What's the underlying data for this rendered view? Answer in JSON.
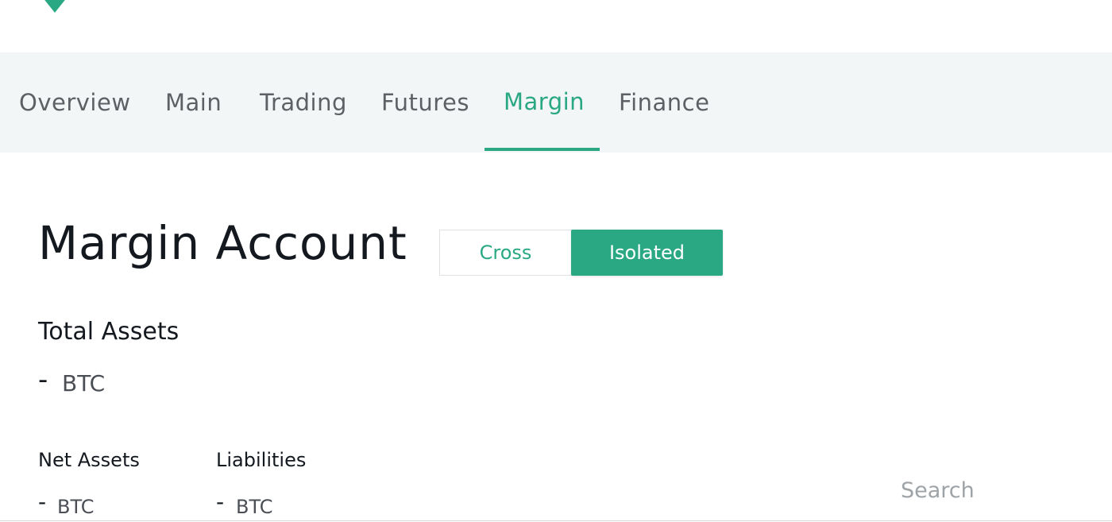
{
  "brand": {
    "accent_color": "#2aa883"
  },
  "nav": {
    "tabs": [
      {
        "label": "Overview"
      },
      {
        "label": "Main"
      },
      {
        "label": "Trading"
      },
      {
        "label": "Futures"
      },
      {
        "label": "Margin",
        "active": true
      },
      {
        "label": "Finance"
      }
    ]
  },
  "page": {
    "title": "Margin Account",
    "mode_toggle": {
      "options": [
        "Cross",
        "Isolated"
      ],
      "selected": "Isolated"
    }
  },
  "total_assets": {
    "label": "Total Assets",
    "value": "-",
    "unit": "BTC"
  },
  "net_assets": {
    "label": "Net Assets",
    "value": "-",
    "unit": "BTC"
  },
  "liabilities": {
    "label": "Liabilities",
    "value": "-",
    "unit": "BTC"
  },
  "search": {
    "placeholder": "Search",
    "value": ""
  }
}
